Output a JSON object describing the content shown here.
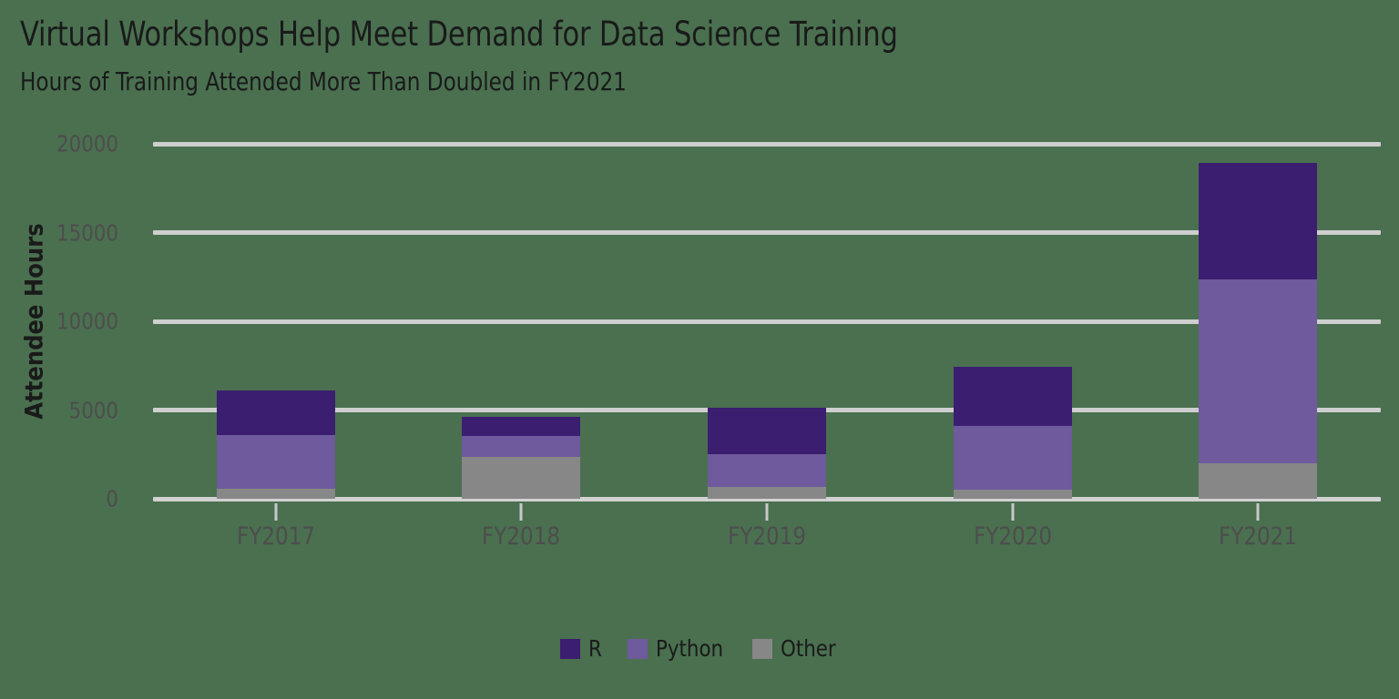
{
  "chart_data": {
    "type": "bar",
    "stacked": true,
    "title": "Virtual Workshops Help Meet Demand for Data Science Training",
    "subtitle": "Hours of Training Attended More Than Doubled in FY2021",
    "xlabel": "",
    "ylabel": "Attendee Hours",
    "categories": [
      "FY2017",
      "FY2018",
      "FY2019",
      "FY2020",
      "FY2021"
    ],
    "series": [
      {
        "name": "Other",
        "color": "#878787",
        "values": [
          565,
          2360,
          670,
          515,
          2000
        ]
      },
      {
        "name": "Python",
        "color": "#6e5a9c",
        "values": [
          3030,
          1180,
          1850,
          3595,
          10370
        ]
      },
      {
        "name": "R",
        "color": "#3b1e70",
        "values": [
          2515,
          1080,
          2620,
          3335,
          6570
        ]
      }
    ],
    "totals": [
      6110,
      4620,
      5140,
      7445,
      18940
    ],
    "ylim": [
      0,
      20000
    ],
    "yticks": [
      0,
      5000,
      10000,
      15000,
      20000
    ],
    "ytick_labels": [
      "0",
      "5000",
      "10000",
      "15000",
      "20000"
    ],
    "grid": true,
    "legend_position": "bottom",
    "legend_order": [
      "R",
      "Python",
      "Other"
    ],
    "background_color": "#4a7050",
    "gridline_color": "#cfcfcf",
    "tick_label_color": "#4d4d4d",
    "title_color": "#1a1a1a"
  },
  "legend": {
    "items": [
      {
        "label": "R",
        "color": "#3b1e70"
      },
      {
        "label": "Python",
        "color": "#6e5a9c"
      },
      {
        "label": "Other",
        "color": "#878787"
      }
    ]
  }
}
